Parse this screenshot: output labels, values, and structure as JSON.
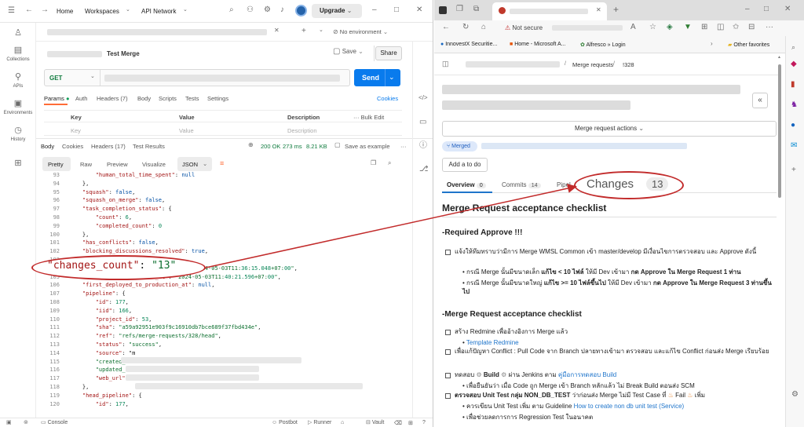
{
  "postman": {
    "nav": {
      "home": "Home",
      "workspaces": "Workspaces",
      "api_network": "API Network",
      "upgrade": "Upgrade"
    },
    "rail": [
      "Collections",
      "APIs",
      "Environments",
      "History"
    ],
    "env": "No environment",
    "request": {
      "name": "Test Merge",
      "save": "Save",
      "share": "Share",
      "method": "GET",
      "send": "Send"
    },
    "req_tabs": [
      "Params",
      "Auth",
      "Headers (7)",
      "Body",
      "Scripts",
      "Tests",
      "Settings"
    ],
    "cookies": "Cookies",
    "params_table": {
      "key_h": "Key",
      "value_h": "Value",
      "desc_h": "Description",
      "bulk": "Bulk Edit",
      "key_ph": "Key",
      "value_ph": "Value",
      "desc_ph": "Description"
    },
    "resp_tabs": [
      "Body",
      "Cookies",
      "Headers (17)",
      "Test Results"
    ],
    "resp_status": {
      "code": "200 OK",
      "time": "273 ms",
      "size": "8.21 KB",
      "save": "Save as example"
    },
    "view_tabs": [
      "Pretty",
      "Raw",
      "Preview",
      "Visualize"
    ],
    "format": "JSON",
    "code": [
      {
        "n": "93",
        "t": "        \"human_total_time_spent\": null"
      },
      {
        "n": "94",
        "t": "    },"
      },
      {
        "n": "95",
        "t": "    \"squash\": false,"
      },
      {
        "n": "96",
        "t": "    \"squash_on_merge\": false,"
      },
      {
        "n": "97",
        "t": "    \"task_completion_status\": {"
      },
      {
        "n": "98",
        "t": "        \"count\": 6,"
      },
      {
        "n": "99",
        "t": "        \"completed_count\": 0"
      },
      {
        "n": "100",
        "t": "    },"
      },
      {
        "n": "101",
        "t": "    \"has_conflicts\": false,"
      },
      {
        "n": "102",
        "t": "    \"blocking_discussions_resolved\": true,"
      },
      {
        "n": "103",
        "t": ""
      },
      {
        "n": "104",
        "t": "                                     \"2024-05-03T11:36:15.048+07:00\","
      },
      {
        "n": "105",
        "t": "    \"latest_build_finished_at\": \"2024-05-03T11:40:21.596+07:00\","
      },
      {
        "n": "106",
        "t": "    \"first_deployed_to_production_at\": null,"
      },
      {
        "n": "107",
        "t": "    \"pipeline\": {"
      },
      {
        "n": "108",
        "t": "        \"id\": 177,"
      },
      {
        "n": "109",
        "t": "        \"iid\": 166,"
      },
      {
        "n": "110",
        "t": "        \"project_id\": 53,"
      },
      {
        "n": "111",
        "t": "        \"sha\": \"a59a92951e903f9c16910db7bce689f37fbd434e\","
      },
      {
        "n": "112",
        "t": "        \"ref\": \"refs/merge-requests/328/head\","
      },
      {
        "n": "113",
        "t": "        \"status\": \"success\","
      },
      {
        "n": "114",
        "t": "        \"source\": \"m"
      },
      {
        "n": "115",
        "t": "        \"created_at\""
      },
      {
        "n": "116",
        "t": "        \"updated_at\""
      },
      {
        "n": "117",
        "t": "        \"web_url\": \""
      },
      {
        "n": "118",
        "t": "    },"
      },
      {
        "n": "119",
        "t": "    \"head_pipeline\": {"
      },
      {
        "n": "120",
        "t": "        \"id\": 177,"
      }
    ],
    "callout": "\"changes_count\": \"13\"",
    "status_bar": {
      "console": "Console",
      "postbot": "Postbot",
      "runner": "Runner",
      "vault": "Vault"
    }
  },
  "edge": {
    "not_secure": "Not secure",
    "favorites": [
      "InnovestX Securitie...",
      "Home - Microsoft A...",
      "Alfresco » Login",
      "Other favorites"
    ],
    "breadcrumb": [
      "Merge requests",
      "!328"
    ],
    "mr_actions": "Merge request actions",
    "state": "Merged",
    "add_todo": "Add a to do",
    "tabs": [
      {
        "label": "Overview",
        "count": "0"
      },
      {
        "label": "Commits",
        "count": "14"
      },
      {
        "label": "Pipel"
      }
    ],
    "changes_callout": {
      "label": "Changes",
      "count": "13"
    },
    "h1": "Merge Request acceptance checklist",
    "h2a": "-Required Approve !!!",
    "req1": "แจ้งให้ทีมทราบว่ามีการ Merge WMSL Common เข้า master/develop มีเงื่อนไขการตรวจสอบ และ Approve ดังนี้",
    "req1a_pre": "กรณี Merge นั้นมีขนาดเล็ก ",
    "req1a_bold": "แก้ไข < 10 ไฟล์",
    "req1a_mid": " ให้มี Dev เข้ามา ",
    "req1a_bold2": "กด Approve ใน Merge Request 1 ท่าน",
    "req1b_pre": "กรณี Merge นั้นมีขนาดใหญ่ ",
    "req1b_bold": "แก้ไข >= 10 ไฟล์ขึ้นไป",
    "req1b_mid": " ให้มี Dev เข้ามา ",
    "req1b_bold2": "กด Approve ใน Merge Request 3 ท่านขึ้นไป",
    "h2b": "-Merge Request acceptance checklist",
    "i1": "สร้าง Redmine เพื่ออ้างอิงการ Merge แล้ว",
    "i1a": "Template Redmine",
    "i2": "เพื่อแก้ปัญหา Conflict : Pull Code จาก Branch ปลายทางเข้ามา ตรวจสอบ และแก้ไข Conflict ก่อนส่ง Merge เรียบร้อย",
    "i3_pre": "ทดสอบ ",
    "i3_bold": "Build",
    "i3_mid": " ผ่าน Jenkins ตาม ",
    "i3_link": "คู่มือการทดสอบ Build",
    "i3a": "เพื่อยืนยันว่า เมื่อ Code ถูก Merge เข้า Branch หลักแล้ว ไม่ Break Build ตอนส่ง SCM",
    "i4_bold": "ตรวจสอบ Unit Test กลุ่ม NON_DB_TEST",
    "i4_rest": " ว่าก่อนส่ง Merge ไม่มี Test Case ที่",
    "i4_fail": "Fail",
    "i4_end": "เพิ่ม",
    "i4a_pre": "ควรเขียน Unit Test เพิ่ม ตาม Guideline ",
    "i4a_link": "How to create non db unit test (Service)",
    "i4b": "เพื่อช่วยลดการการ Regression Test ในอนาคต"
  }
}
